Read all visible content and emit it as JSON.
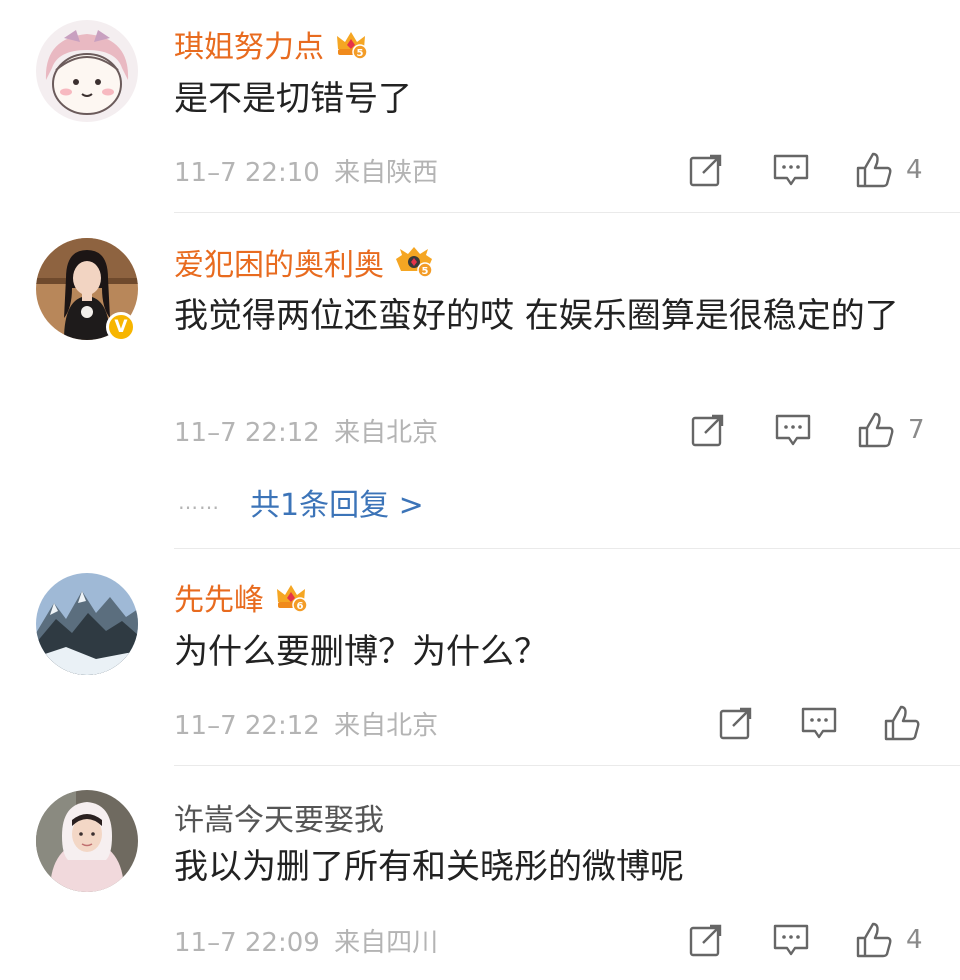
{
  "colors": {
    "username": "#e86b1f",
    "plain_username": "#555555",
    "meta": "#b4b4b4",
    "reply_link": "#3c74b8",
    "verified_badge": "#f7b500"
  },
  "comments": [
    {
      "username": "琪姐努力点",
      "badge": "crown-5",
      "badge_level": "5",
      "text": "是不是切错号了",
      "time": "11–7 22:10",
      "location": "来自陕西",
      "likes": "4"
    },
    {
      "username": "爱犯困的奥利奥",
      "badge": "crown-5",
      "badge_level": "5",
      "verified": true,
      "verified_mark": "V",
      "text": "我觉得两位还蛮好的哎 在娱乐圈算是很稳定的了",
      "time": "11–7 22:12",
      "location": "来自北京",
      "likes": "7",
      "replies": {
        "dots": "……",
        "label": "共1条回复 >"
      }
    },
    {
      "username": "先先峰",
      "badge": "crown-6",
      "badge_level": "6",
      "text": "为什么要删博？为什么？",
      "time": "11–7 22:12",
      "location": "来自北京",
      "likes": ""
    },
    {
      "username": "许嵩今天要娶我",
      "text": "我以为删了所有和关晓彤的微博呢",
      "time": "11–7 22:09",
      "location": "来自四川",
      "likes": "4"
    }
  ]
}
